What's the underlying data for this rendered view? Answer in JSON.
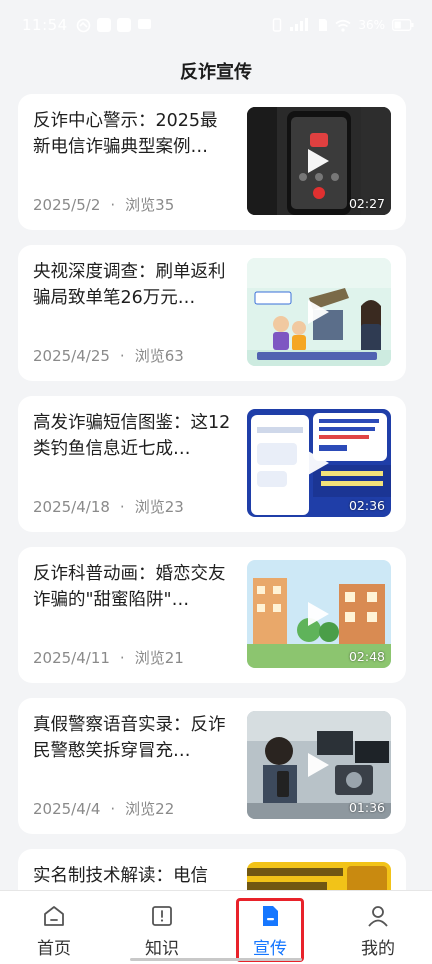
{
  "status_bar": {
    "time": "11:54",
    "battery": "36%"
  },
  "header": {
    "title": "反诈宣传"
  },
  "articles": [
    {
      "title": "反诈中心警示：2025最新电信诈骗典型案例…",
      "date": "2025/5/2",
      "views": "浏览35",
      "duration": "02:27",
      "thumb": "phone-call"
    },
    {
      "title": "央视深度调查：刷单返利骗局致单笔26万元…",
      "date": "2025/4/25",
      "views": "浏览63",
      "duration": "",
      "thumb": "cartoon-scam"
    },
    {
      "title": "高发诈骗短信图鉴：这12类钓鱼信息近七成…",
      "date": "2025/4/18",
      "views": "浏览23",
      "duration": "02:36",
      "thumb": "sms-screen"
    },
    {
      "title": "反诈科普动画：婚恋交友诈骗的\"甜蜜陷阱\"…",
      "date": "2025/4/11",
      "views": "浏览21",
      "duration": "02:48",
      "thumb": "animation-street"
    },
    {
      "title": "真假警察语音实录：反诈民警憨笑拆穿冒充…",
      "date": "2025/4/4",
      "views": "浏览22",
      "duration": "01:36",
      "thumb": "police-office"
    },
    {
      "title": "实名制技术解读：电信",
      "date": "",
      "views": "",
      "duration": "",
      "thumb": "yellow-banner"
    }
  ],
  "tabbar": {
    "tabs": [
      {
        "label": "首页",
        "icon": "home-icon"
      },
      {
        "label": "知识",
        "icon": "book-icon"
      },
      {
        "label": "宣传",
        "icon": "document-icon",
        "active": true
      },
      {
        "label": "我的",
        "icon": "user-icon"
      }
    ],
    "active_color": "#1677ff",
    "highlight_color": "#e8222a"
  }
}
